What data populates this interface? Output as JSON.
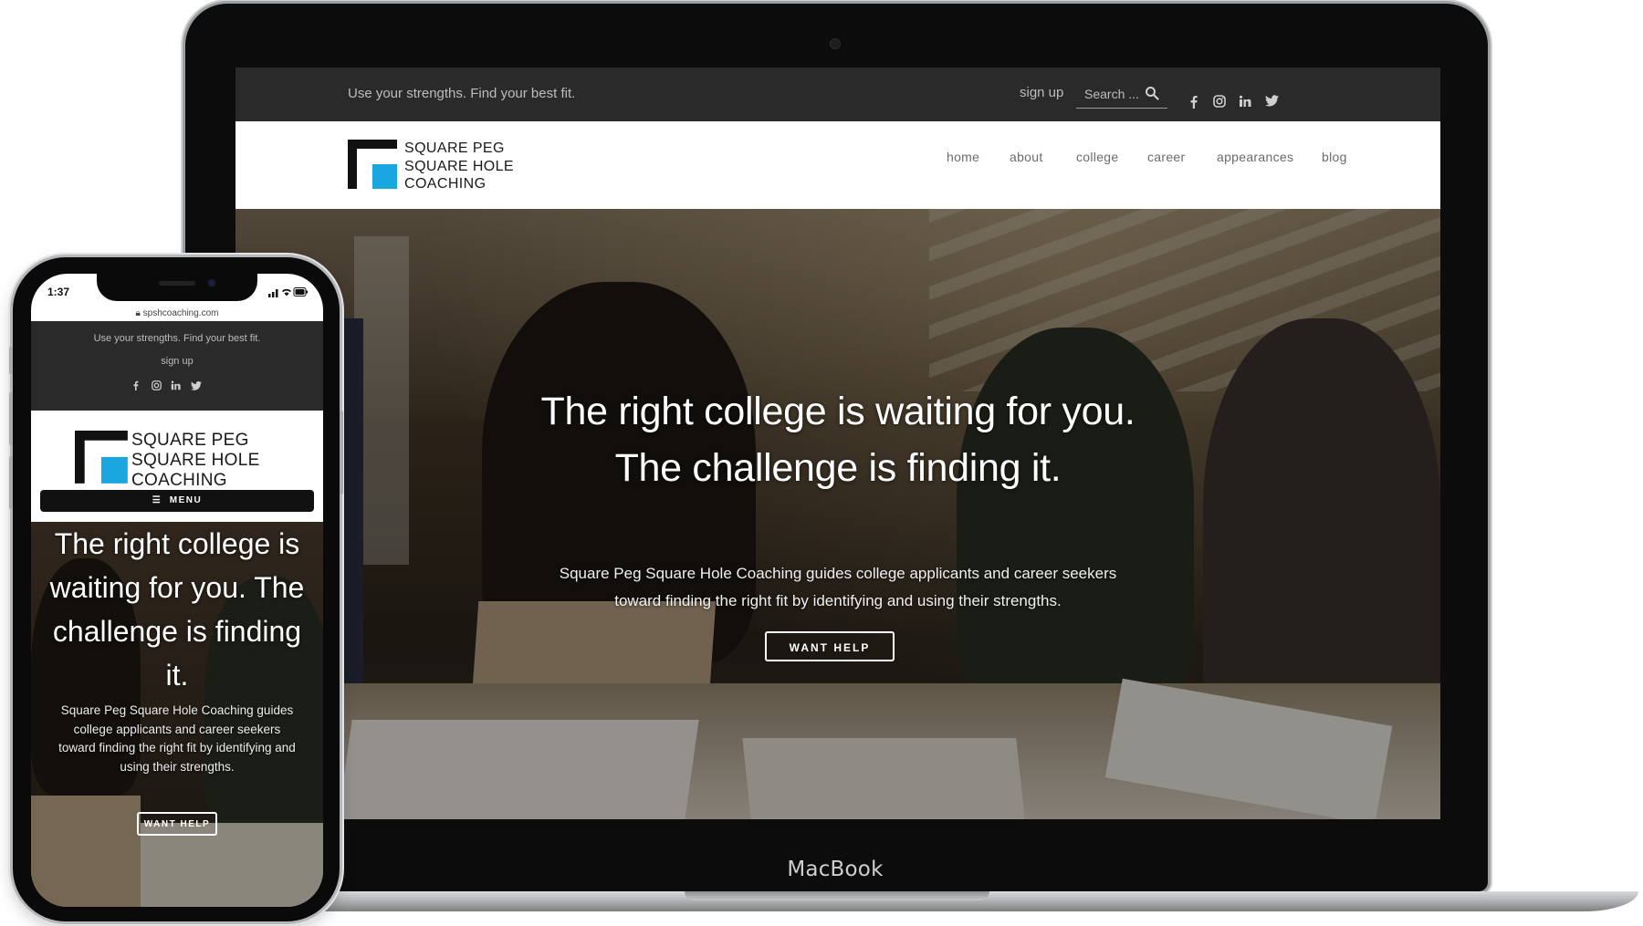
{
  "laptop": {
    "brand_label": "MacBook",
    "site": {
      "tagline": "Use your strengths. Find your best fit.",
      "signup": "sign up",
      "search_placeholder": "Search ...",
      "social": [
        "facebook-icon",
        "instagram-icon",
        "linkedin-icon",
        "twitter-icon"
      ],
      "logo_lines": [
        "SQUARE PEG",
        "SQUARE HOLE",
        "COACHING"
      ],
      "nav": [
        "home",
        "about",
        "college",
        "career",
        "appearances",
        "blog"
      ],
      "hero_heading_line1": "The right college is waiting for you.",
      "hero_heading_line2": "The challenge is finding it.",
      "hero_paragraph": "Square Peg Square Hole Coaching guides college applicants and career seekers toward finding the right fit by identifying and using their strengths.",
      "hero_button": "WANT HELP"
    }
  },
  "phone": {
    "status_time": "1:37",
    "url": "spshcoaching.com",
    "site": {
      "tagline": "Use your strengths. Find your best fit.",
      "signup": "sign up",
      "logo_lines": [
        "SQUARE PEG",
        "SQUARE HOLE",
        "COACHING"
      ],
      "menu_label": "MENU",
      "hero_heading": "The right college is waiting for you. The challenge is finding it.",
      "hero_paragraph": "Square Peg Square Hole Coaching guides college applicants and career seekers toward finding the right fit by identifying and using their strengths.",
      "hero_button": "WANT HELP"
    }
  },
  "colors": {
    "topbar_bg": "#2a2a2a",
    "logo_blue": "#1aa6df",
    "logo_black": "#111111"
  }
}
